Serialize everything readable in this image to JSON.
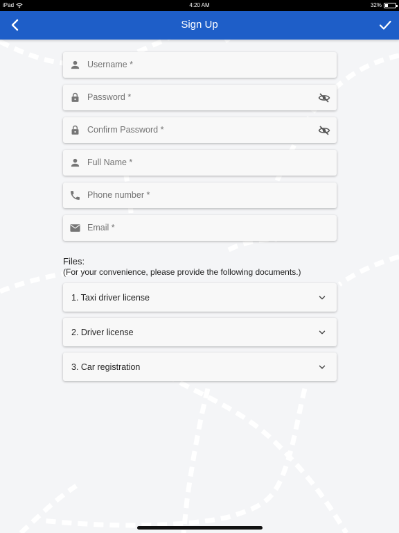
{
  "status_bar": {
    "device": "iPad",
    "time": "4:20 AM",
    "battery": "32%",
    "battery_level": 0.32
  },
  "app_bar": {
    "title": "Sign Up",
    "back_icon": "chevron-left-icon",
    "confirm_icon": "check-icon"
  },
  "form": {
    "fields": [
      {
        "placeholder": "Username *",
        "icon": "person-icon"
      },
      {
        "placeholder": "Password *",
        "icon": "lock-icon",
        "toggle_icon": "visibility-off-icon"
      },
      {
        "placeholder": "Confirm Password *",
        "icon": "lock-icon",
        "toggle_icon": "visibility-off-icon"
      },
      {
        "placeholder": "Full Name *",
        "icon": "person-icon"
      },
      {
        "placeholder": "Phone number *",
        "icon": "phone-icon"
      },
      {
        "placeholder": "Email *",
        "icon": "mail-icon"
      }
    ]
  },
  "files": {
    "heading": "Files:",
    "subtitle": "(For your convenience, please provide the following documents.)",
    "items": [
      {
        "label": "1. Taxi driver license"
      },
      {
        "label": "2. Driver license"
      },
      {
        "label": "3. Car registration"
      }
    ]
  },
  "colors": {
    "app_bar": "#1e5ec8",
    "background": "#f4f5f7",
    "icon_gray": "#757575"
  }
}
